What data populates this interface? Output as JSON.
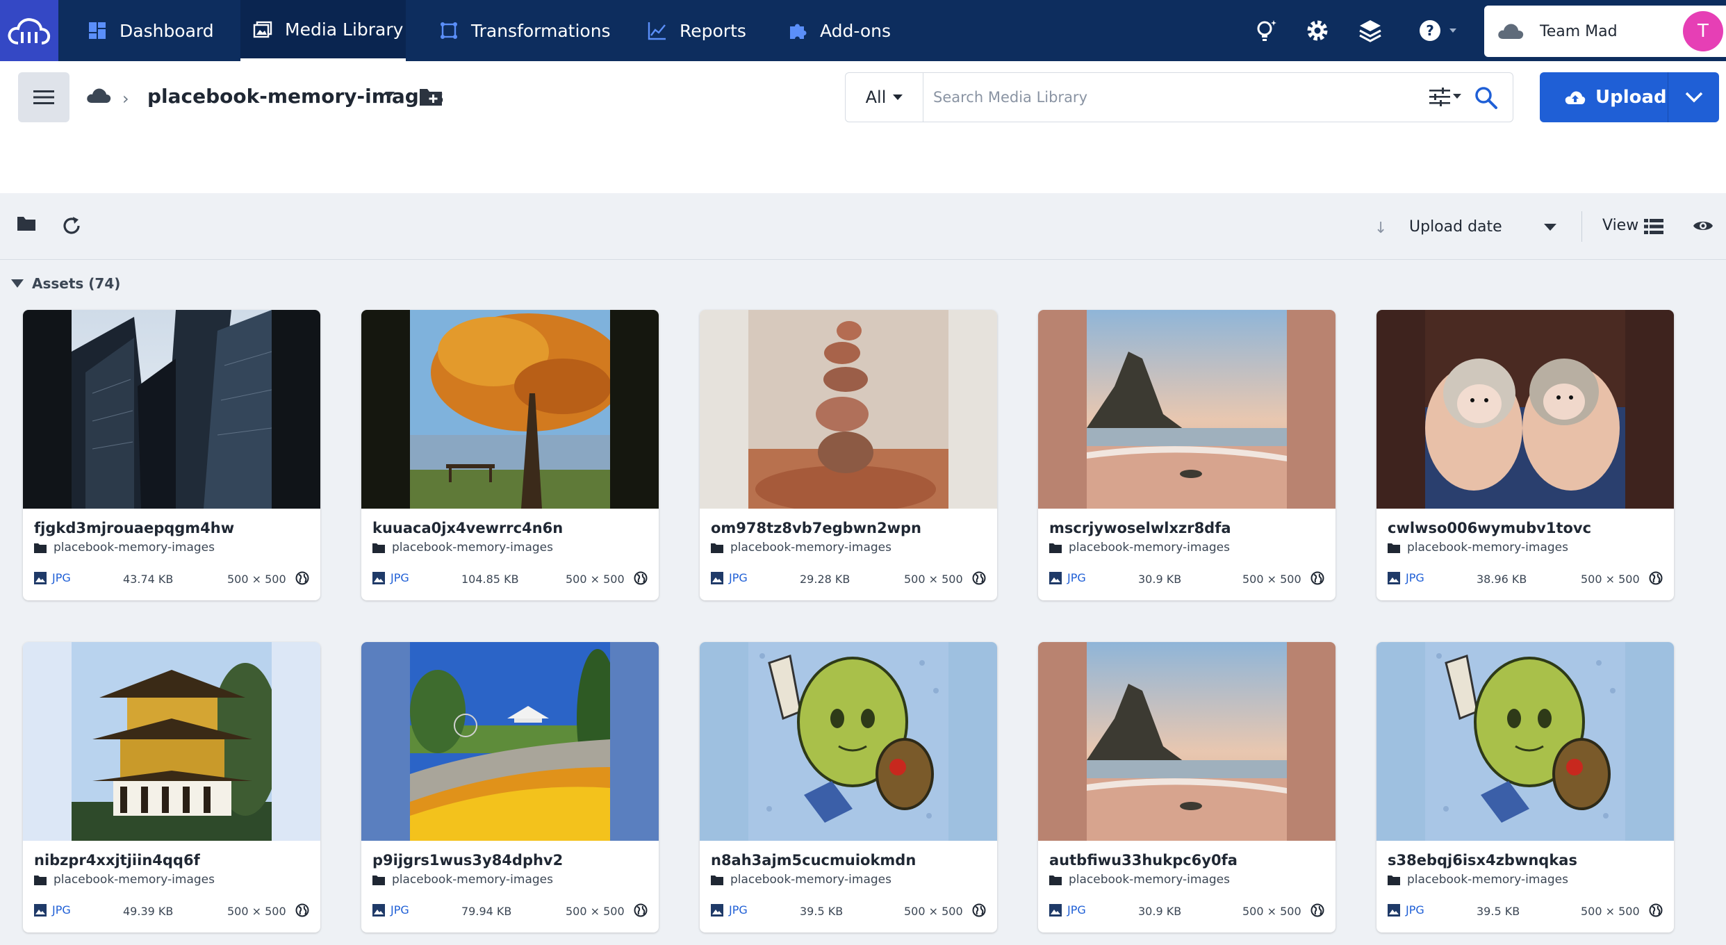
{
  "nav": {
    "items": [
      {
        "label": "Dashboard",
        "icon": "dashboard-icon"
      },
      {
        "label": "Media Library",
        "icon": "media-library-icon",
        "active": true
      },
      {
        "label": "Transformations",
        "icon": "transformations-icon"
      },
      {
        "label": "Reports",
        "icon": "reports-icon"
      },
      {
        "label": "Add-ons",
        "icon": "puzzle-icon"
      }
    ],
    "right_icons": [
      "lightbulb-icon",
      "gear-icon",
      "stack-icon",
      "help-icon"
    ],
    "team_name": "Team Mad",
    "avatar_initial": "T"
  },
  "header": {
    "folder_name": "placebook-memory-images",
    "search_scope": "All",
    "search_placeholder": "Search Media Library",
    "upload_label": "Upload"
  },
  "toolbar": {
    "sort_label": "Upload date",
    "view_label": "View"
  },
  "assets": {
    "heading": "Assets (74)",
    "items": [
      {
        "name": "fjgkd3mjrouaepqgm4hw",
        "folder": "placebook-memory-images",
        "format": "JPG",
        "size": "43.74 KB",
        "dims": "500 × 500",
        "bg": "#101418",
        "scene": "buildings"
      },
      {
        "name": "kuuaca0jx4vewrrc4n6n",
        "folder": "placebook-memory-images",
        "format": "JPG",
        "size": "104.85 KB",
        "dims": "500 × 500",
        "bg": "#15170f",
        "scene": "autumn-tree"
      },
      {
        "name": "om978tz8vb7egbwn2wpn",
        "folder": "placebook-memory-images",
        "format": "JPG",
        "size": "29.28 KB",
        "dims": "500 × 500",
        "bg": "#e6e2dc",
        "scene": "stones"
      },
      {
        "name": "mscrjywoselwlxzr8dfa",
        "folder": "placebook-memory-images",
        "format": "JPG",
        "size": "30.9 KB",
        "dims": "500 × 500",
        "bg": "#b98370",
        "scene": "beach"
      },
      {
        "name": "cwlwso006wymubv1tovc",
        "folder": "placebook-memory-images",
        "format": "JPG",
        "size": "38.96 KB",
        "dims": "500 × 500",
        "bg": "#3e231e",
        "scene": "hedgehogs"
      },
      {
        "name": "nibzpr4xxjtjiin4qq6f",
        "folder": "placebook-memory-images",
        "format": "JPG",
        "size": "49.39 KB",
        "dims": "500 × 500",
        "bg": "#dce7f6",
        "scene": "pagoda"
      },
      {
        "name": "p9ijgrs1wus3y84dphv2",
        "folder": "placebook-memory-images",
        "format": "JPG",
        "size": "79.94 KB",
        "dims": "500 × 500",
        "bg": "#5a7fbf",
        "scene": "garden"
      },
      {
        "name": "n8ah3ajm5cucmuiokmdn",
        "folder": "placebook-memory-images",
        "format": "JPG",
        "size": "39.5 KB",
        "dims": "500 × 500",
        "bg": "#9ec0e0",
        "scene": "bean"
      },
      {
        "name": "autbfiwu33hukpc6y0fa",
        "folder": "placebook-memory-images",
        "format": "JPG",
        "size": "30.9 KB",
        "dims": "500 × 500",
        "bg": "#b98370",
        "scene": "beach"
      },
      {
        "name": "s38ebqj6isx4zbwnqkas",
        "folder": "placebook-memory-images",
        "format": "JPG",
        "size": "39.5 KB",
        "dims": "500 × 500",
        "bg": "#9ec0e0",
        "scene": "bean"
      }
    ]
  }
}
